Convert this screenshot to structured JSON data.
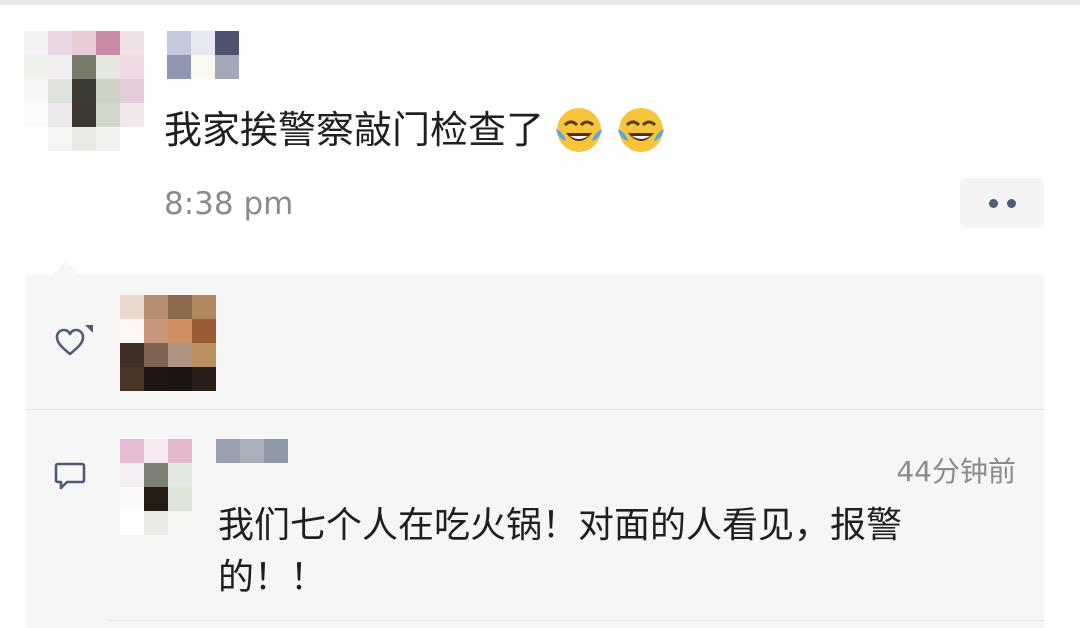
{
  "post": {
    "text": "我家挨警察敲门检查了",
    "emojis": [
      "tears-of-joy-icon",
      "tears-of-joy-icon"
    ],
    "time": "8:38 pm",
    "more_icon": "more-dots-icon"
  },
  "likes": {
    "icon": "heart-icon"
  },
  "comment": {
    "icon": "comment-icon",
    "time": "44分钟前",
    "text": "我们七个人在吃火锅！对面的人看见，报警的！！"
  },
  "colors": {
    "link_blue": "#4e5a7a",
    "panel_bg": "#f6f6f6",
    "time_gray": "#8b8b8b"
  },
  "mosaics": {
    "post_avatar": [
      "#f4f2f4",
      "#e9d7e3",
      "#e8cdd9",
      "#c889a4",
      "#efdfe7",
      "#eef1ec",
      "#f1edf0",
      "#7a7b6a",
      "#e4e9e0",
      "#eed9e5",
      "#f7f6f7",
      "#dfe2dd",
      "#3d3c32",
      "#cdd4c6",
      "#e5ccda",
      "#fcfcfc",
      "#eceaec",
      "#3c3a30",
      "#d0d7c9",
      "#f2e9ee",
      "#ffffff",
      "#f6f5f6",
      "#e9ebe6",
      "#f2f3f1",
      "#ffffff"
    ],
    "post_name": [
      "#c3c8db",
      "#e8e9f0",
      "#4f5371",
      "#8f97b3",
      "#fbfaf0",
      "#a3a8b8"
    ],
    "liker_avatar": [
      "#e9d8ce",
      "#b48d6e",
      "#8e6b4c",
      "#b2895f",
      "#fdf8f6",
      "#c8967a",
      "#d08f5e",
      "#9c5c35",
      "#3f2f28",
      "#7e6552",
      "#ad9584",
      "#bb9060",
      "#4a3626",
      "#1d1614",
      "#1a1412",
      "#2a1f18"
    ],
    "commenter_avatar": [
      "#e5bcd2",
      "#f3ebf0",
      "#e4b7cb",
      "#f5f0f3",
      "#7d8074",
      "#e4e8e2",
      "#fbfafb",
      "#241d14",
      "#dfe5da",
      "#ffffff",
      "#e8eae6",
      "#f5f6f4"
    ],
    "commenter_name": [
      "#98a0b0",
      "#aab1bd",
      "#8f98a6"
    ]
  }
}
